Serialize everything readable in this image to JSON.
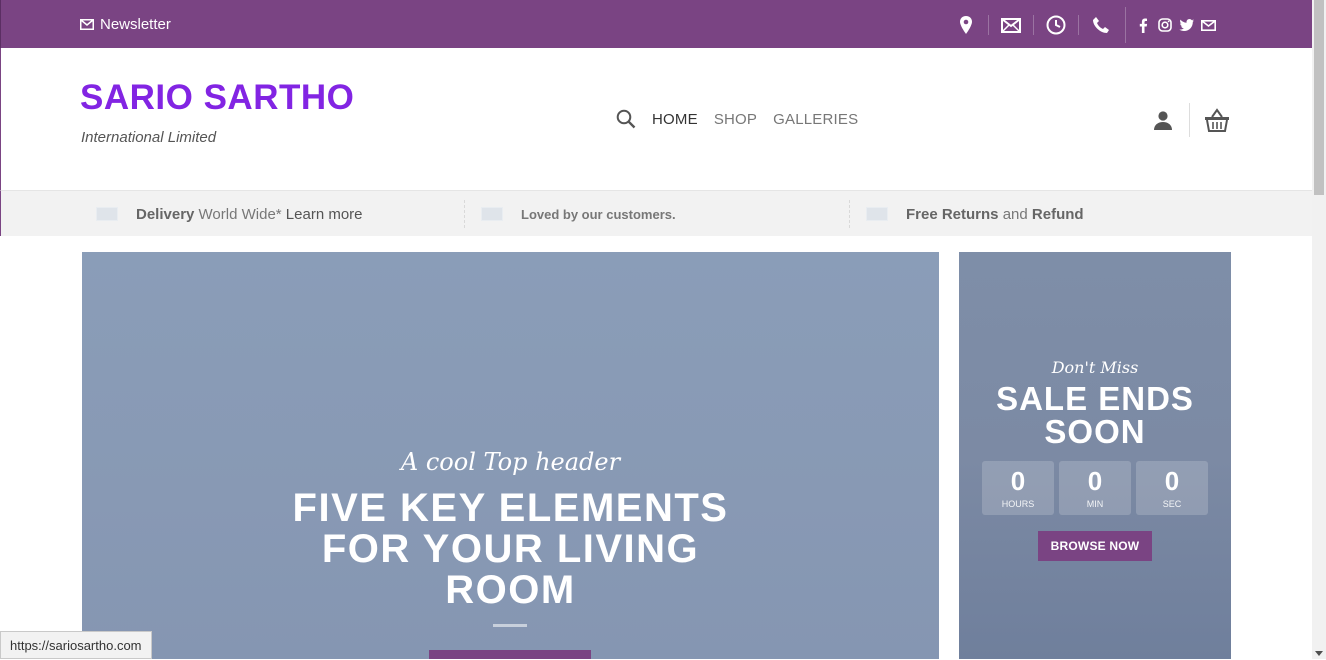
{
  "topbar": {
    "newsletter_label": "Newsletter",
    "icons": [
      "location-icon",
      "mail-icon",
      "clock-icon",
      "phone-icon"
    ],
    "social": [
      "facebook-icon",
      "instagram-icon",
      "twitter-icon",
      "mail-icon"
    ]
  },
  "header": {
    "logo_title": "SARIO SARTHO",
    "logo_subtitle": "International Limited",
    "nav": {
      "home": "HOME",
      "shop": "SHOP",
      "galleries": "GALLERIES"
    }
  },
  "strip": {
    "item1_bold": "Delivery",
    "item1_text": " World Wide* ",
    "item1_link": "Learn more",
    "item2_text": "Loved by our customers.",
    "item3_bold": "Free Returns",
    "item3_and": " and ",
    "item3_bold2": "Refund"
  },
  "hero": {
    "script": "A cool Top header",
    "title_line1": "FIVE KEY ELEMENTS",
    "title_line2": "FOR YOUR LIVING",
    "title_line3": "ROOM"
  },
  "promo": {
    "dont_miss": "Don't Miss",
    "sale_line1": "SALE ENDS",
    "sale_line2": "SOON",
    "hours": "0",
    "hours_label": "HOURS",
    "min": "0",
    "min_label": "MIN",
    "sec": "0",
    "sec_label": "SEC",
    "browse": "BROWSE NOW"
  },
  "status_url": "https://sariosartho.com",
  "colors": {
    "brand_purple": "#7a4483",
    "logo_purple": "#8224e3"
  }
}
